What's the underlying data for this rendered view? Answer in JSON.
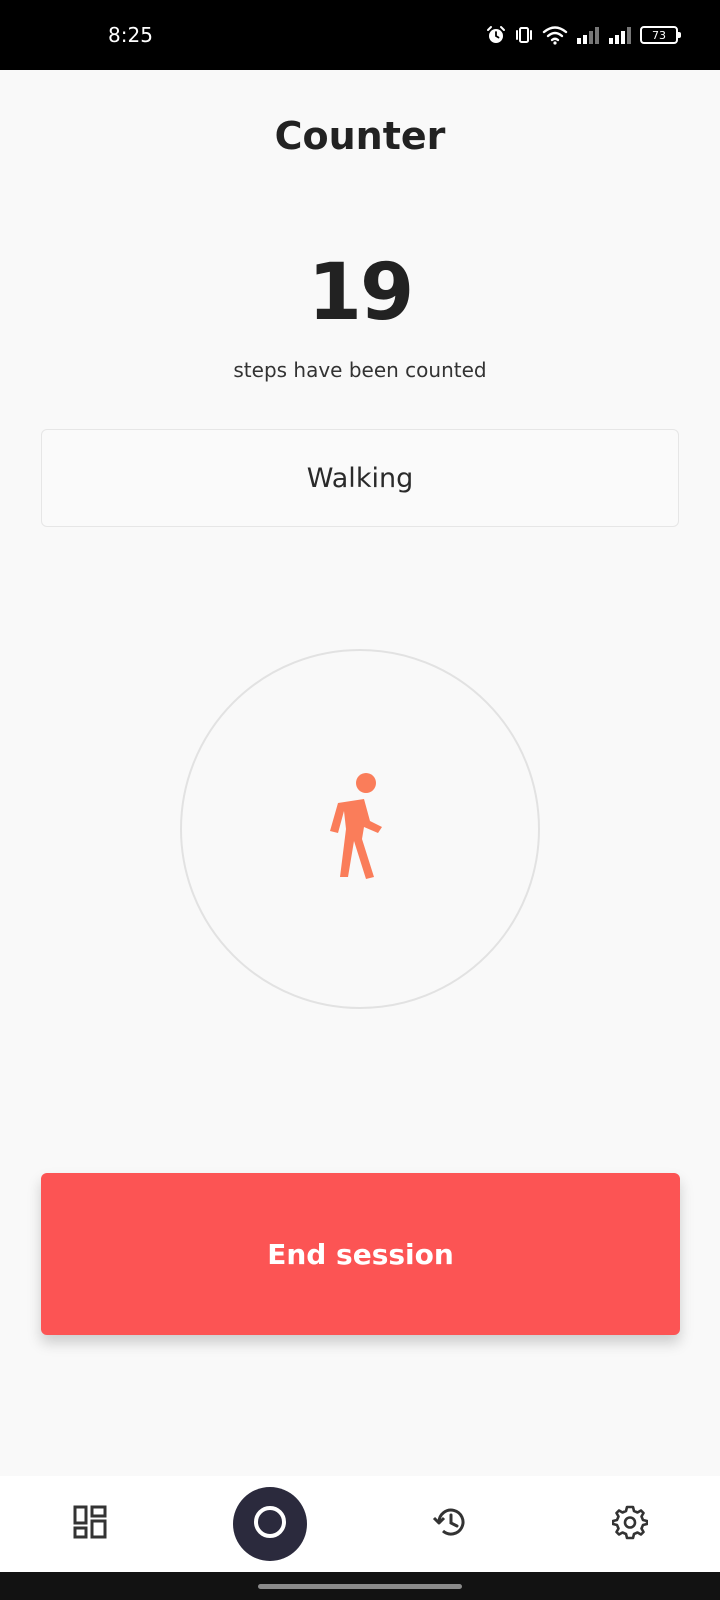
{
  "status_bar": {
    "time": "8:25",
    "battery_level": "73",
    "icons": [
      "alarm-icon",
      "vibrate-icon",
      "wifi-icon",
      "signal-icon",
      "signal-icon",
      "battery-icon"
    ]
  },
  "header": {
    "title": "Counter"
  },
  "counter": {
    "steps": "19",
    "caption": "steps have been counted"
  },
  "activity": {
    "label": "Walking",
    "icon": "walking-person-icon",
    "icon_color": "#fa7d5a"
  },
  "actions": {
    "end_session_label": "End session",
    "end_session_color": "#fc5454"
  },
  "bottom_nav": {
    "items": [
      {
        "icon": "dashboard-icon"
      },
      {
        "icon": "record-circle-icon"
      },
      {
        "icon": "history-icon"
      },
      {
        "icon": "settings-gear-icon"
      }
    ]
  }
}
